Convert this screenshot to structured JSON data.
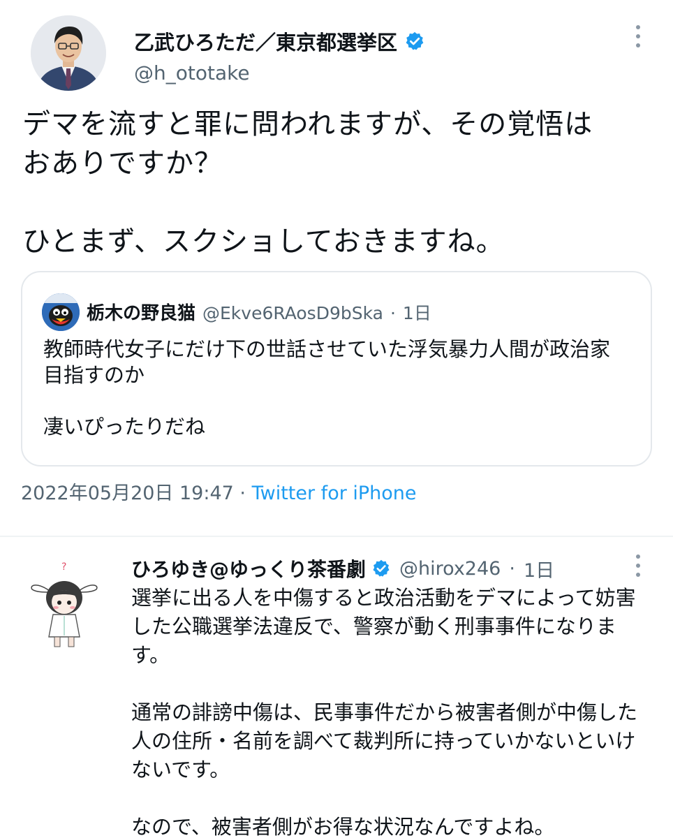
{
  "main_tweet": {
    "display_name": "乙武ひろただ／東京都選挙区",
    "handle": "@h_ototake",
    "text_lines": [
      "デマを流すと罪に問われますが、その覚悟は",
      "おありですか？",
      "",
      "ひとまず、スクショしておきますね。"
    ],
    "quoted": {
      "display_name": "栃木の野良猫",
      "handle": "@Ekve6RAosD9bSka",
      "separator": "·",
      "time": "1日",
      "text_lines": [
        "教師時代女子にだけ下の世話させていた浮気暴力人間が政治家",
        "目指すのか",
        "",
        "凄いぴったりだね"
      ]
    },
    "timestamp": "2022年05月20日 19:47",
    "separator": "·",
    "source": "Twitter for iPhone"
  },
  "reply_tweet": {
    "display_name": "ひろゆき@ゆっくり茶番劇",
    "handle": "@hirox246",
    "separator": "·",
    "time": "1日",
    "text_lines": [
      "選挙に出る人を中傷すると政治活動をデマによって妨害",
      "した公職選挙法違反で、警察が動く刑事事件になりま",
      "す。",
      "",
      "通常の誹謗中傷は、民事事件だから被害者側が中傷した",
      "人の住所・名前を調べて裁判所に持っていかないといけ",
      "ないです。",
      "",
      "なので、被害者側がお得な状況なんですよね。"
    ]
  },
  "icons": {
    "verified": "verified-badge-icon",
    "more": "more-options-icon"
  },
  "colors": {
    "verified": "#1d9bf0",
    "link": "#1d9bf0",
    "secondary_text": "#536471",
    "border": "#e4e8ec"
  }
}
